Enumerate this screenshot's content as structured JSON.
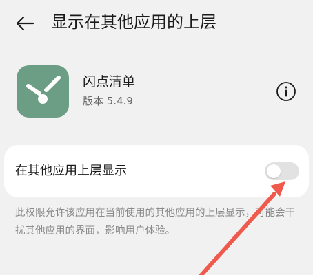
{
  "header": {
    "title": "显示在其他应用的上层"
  },
  "app": {
    "name": "闪点清单",
    "version": "版本 5.4.9",
    "icon_color": "#6b9e84"
  },
  "setting": {
    "label": "在其他应用上层显示",
    "enabled": false
  },
  "description": "此权限允许该应用在当前使用的其他应用的上层显示，可能会干扰其他应用的界面，影响用户体验。",
  "annotation": {
    "arrow_color": "#ef5a4c"
  },
  "icons": {
    "back": "back-arrow-icon",
    "info": "info-icon"
  }
}
